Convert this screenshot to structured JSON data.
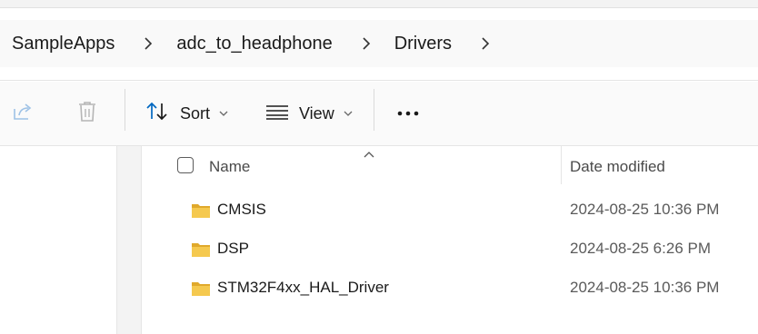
{
  "breadcrumb": {
    "items": [
      "SampleApps",
      "adc_to_headphone",
      "Drivers"
    ]
  },
  "toolbar": {
    "sort_label": "Sort",
    "view_label": "View"
  },
  "icons": {
    "share": "share-icon",
    "delete": "trash-icon",
    "sort": "sort-icon",
    "view": "view-list-icon",
    "more": "more-icon",
    "folder": "folder-icon"
  },
  "columns": {
    "name": "Name",
    "date_modified": "Date modified"
  },
  "files": [
    {
      "name": "CMSIS",
      "date": "2024-08-25 10:36 PM"
    },
    {
      "name": "DSP",
      "date": "2024-08-25 6:26 PM"
    },
    {
      "name": "STM32F4xx_HAL_Driver",
      "date": "2024-08-25 10:36 PM"
    }
  ],
  "colors": {
    "folder": "#f2c14e",
    "folder_dark": "#e0a92c",
    "accent": "#0067c0"
  }
}
